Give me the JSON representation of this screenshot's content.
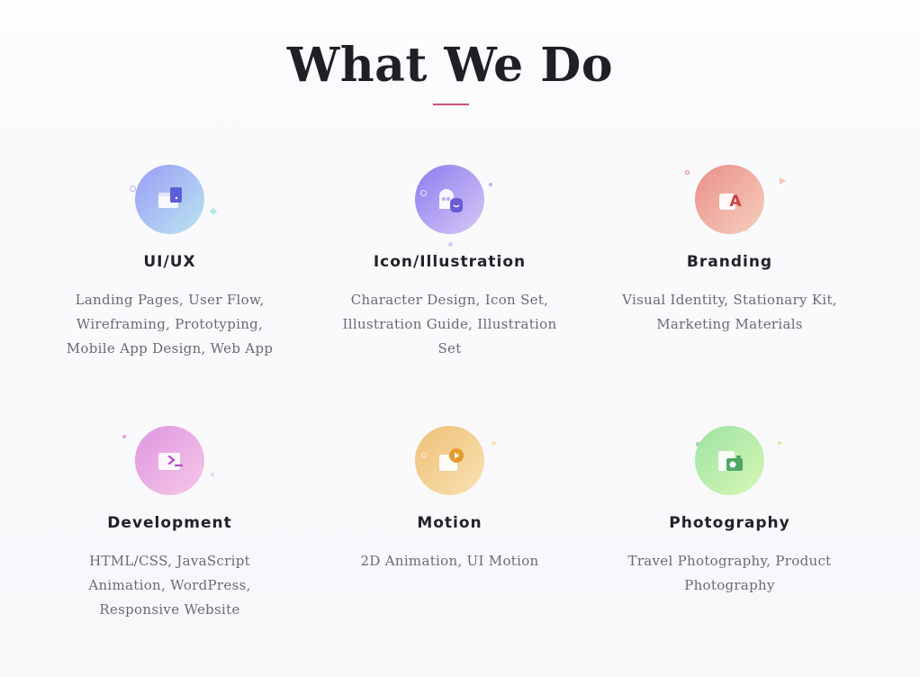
{
  "section": {
    "title": "What We Do",
    "accent_color": "#d0517a"
  },
  "services": [
    {
      "title": "UI/UX",
      "description": "Landing Pages, User Flow, Wireframing, Prototyping, Mobile App Design, Web App",
      "icon": "ui-ux-icon",
      "gradient": [
        "#9b9cf6",
        "#b9e6f0"
      ]
    },
    {
      "title": "Icon/Illustration",
      "description": "Character Design, Icon Set, Illustration Guide, Illustration Set",
      "icon": "illustration-icon",
      "gradient": [
        "#8b7cf0",
        "#d8c8f6"
      ]
    },
    {
      "title": "Branding",
      "description": "Visual Identity, Stationary Kit, Marketing Materials",
      "icon": "branding-icon",
      "gradient": [
        "#e88f8a",
        "#f7d0bd"
      ]
    },
    {
      "title": "Development",
      "description": "HTML/CSS, JavaScript Animation, WordPress, Responsive Website",
      "icon": "development-icon",
      "gradient": [
        "#dd96e0",
        "#f6c7e6"
      ]
    },
    {
      "title": "Motion",
      "description": "2D Animation, UI Motion",
      "icon": "motion-icon",
      "gradient": [
        "#efc07a",
        "#f8e2b0"
      ]
    },
    {
      "title": "Photography",
      "description": "Travel Photography, Product Photography",
      "icon": "camera-icon",
      "gradient": [
        "#9be3a4",
        "#d9f7b4"
      ]
    }
  ]
}
